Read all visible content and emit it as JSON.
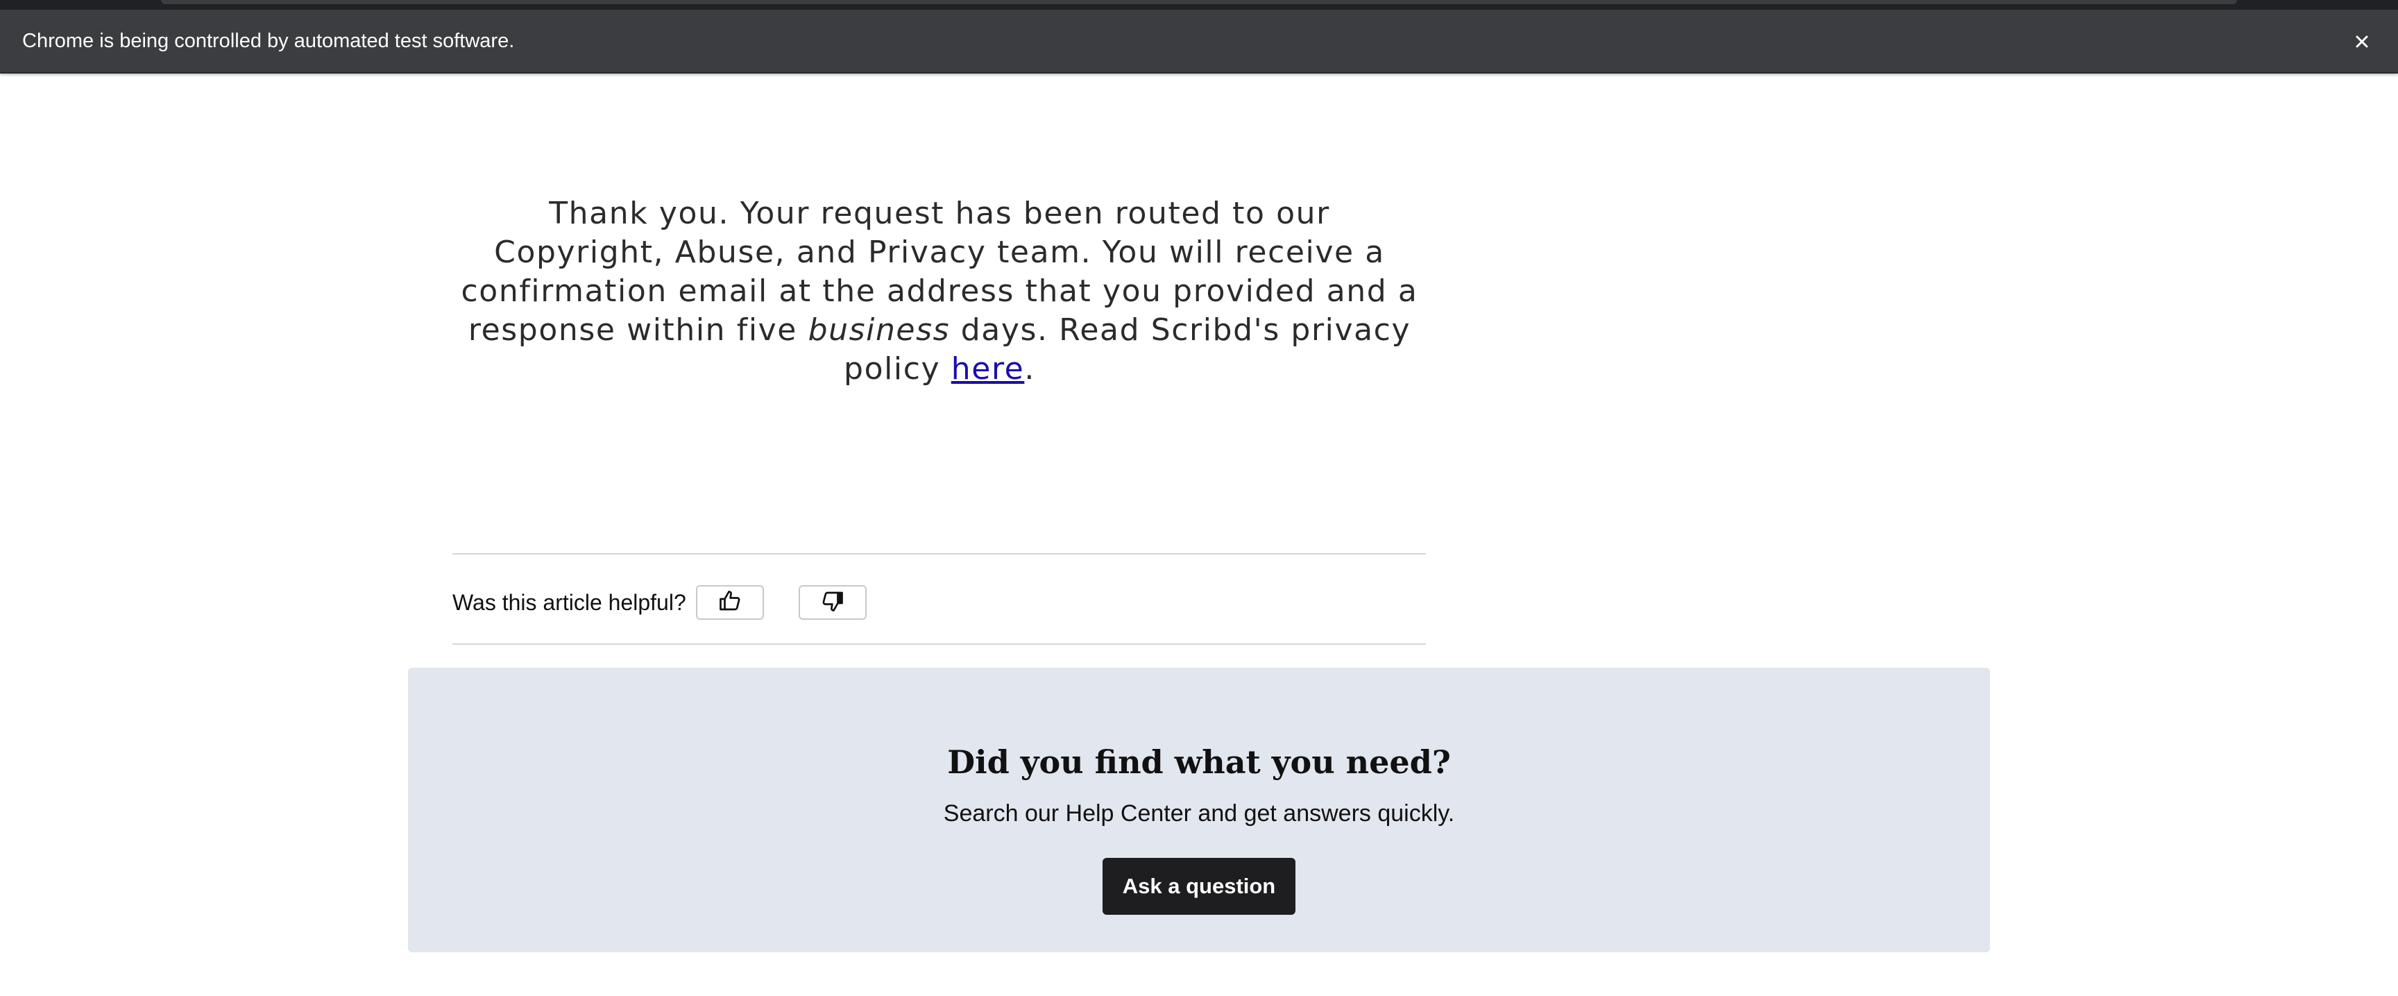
{
  "browser": {
    "infobar_text": "Chrome is being controlled by automated test software.",
    "close_icon": "close-icon"
  },
  "article": {
    "message_part1": "Thank you. Your request has been routed to our Copyright, Abuse, and Privacy team. You will receive a confirmation email at the address that you provided and a response within five",
    "message_emphasis": "business",
    "message_part2": "days. Read Scribd's privacy policy",
    "message_link": "here",
    "message_end": "."
  },
  "feedback": {
    "question": "Was this article helpful?",
    "up_icon": "thumbs-up-icon",
    "down_icon": "thumbs-down-icon"
  },
  "help_panel": {
    "title": "Did you find what you need?",
    "subtitle": "Search our Help Center and get answers quickly.",
    "button_label": "Ask a question",
    "background_color": "#e2e6ee",
    "button_color": "#1e1e20"
  },
  "colors": {
    "link": "#1a0dab",
    "infobar": "#3c3d41"
  }
}
